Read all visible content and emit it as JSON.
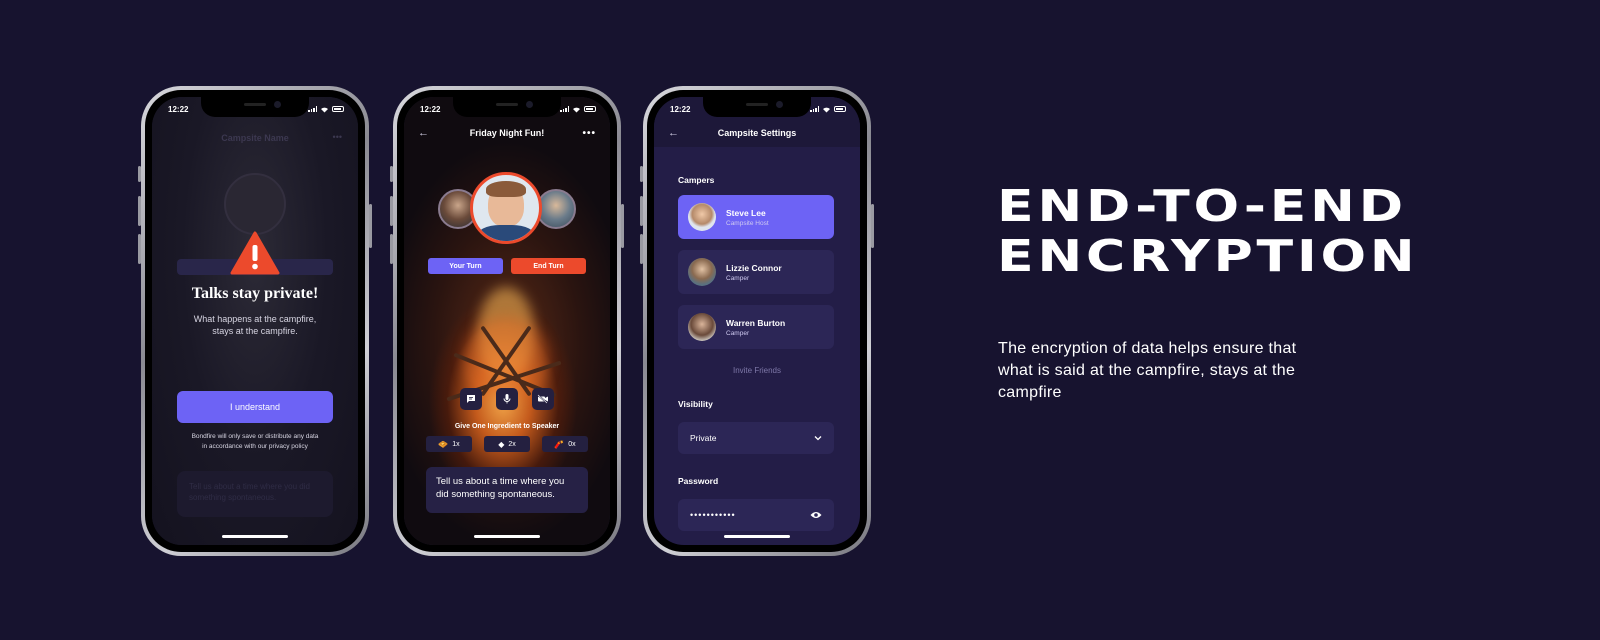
{
  "status_time": "12:22",
  "phone1": {
    "ghost_title": "Campsite Name",
    "title": "Talks stay private!",
    "subtitle_line1": "What happens at the campfire,",
    "subtitle_line2": "stays at the campfire.",
    "button_label": "I understand",
    "note_line1": "Bondfire will only save or distribute any data",
    "note_line2": "in accordance with our privacy policy",
    "ghost_card": "Tell us about a time where you did something spontaneous."
  },
  "phone2": {
    "title": "Friday Night Fun!",
    "your_turn": "Your Turn",
    "end_turn": "End Turn",
    "ingredient_title": "Give One Ingredient to Speaker",
    "chips": [
      {
        "icon": "🧇",
        "count": "1x"
      },
      {
        "icon": "◆",
        "count": "2x"
      },
      {
        "icon": "🧨",
        "count": "0x"
      }
    ],
    "prompt": "Tell us about a time where you did something spontaneous."
  },
  "phone3": {
    "title": "Campsite Settings",
    "campers_label": "Campers",
    "campers": [
      {
        "name": "Steve Lee",
        "role": "Campsite Host"
      },
      {
        "name": "Lizzie Connor",
        "role": "Camper"
      },
      {
        "name": "Warren Burton",
        "role": "Camper"
      }
    ],
    "invite": "Invite Friends",
    "visibility_label": "Visibility",
    "visibility_value": "Private",
    "password_label": "Password",
    "password_value": "•••••••••••"
  },
  "headline_line1": "END-TO-END",
  "headline_line2": "ENCRYPTION",
  "body": "The encryption of data helps ensure that what is said at the campfire, stays at the campfire",
  "colors": {
    "background": "#17132f",
    "accent_purple": "#6d63f5",
    "accent_red": "#ec4a2c"
  }
}
